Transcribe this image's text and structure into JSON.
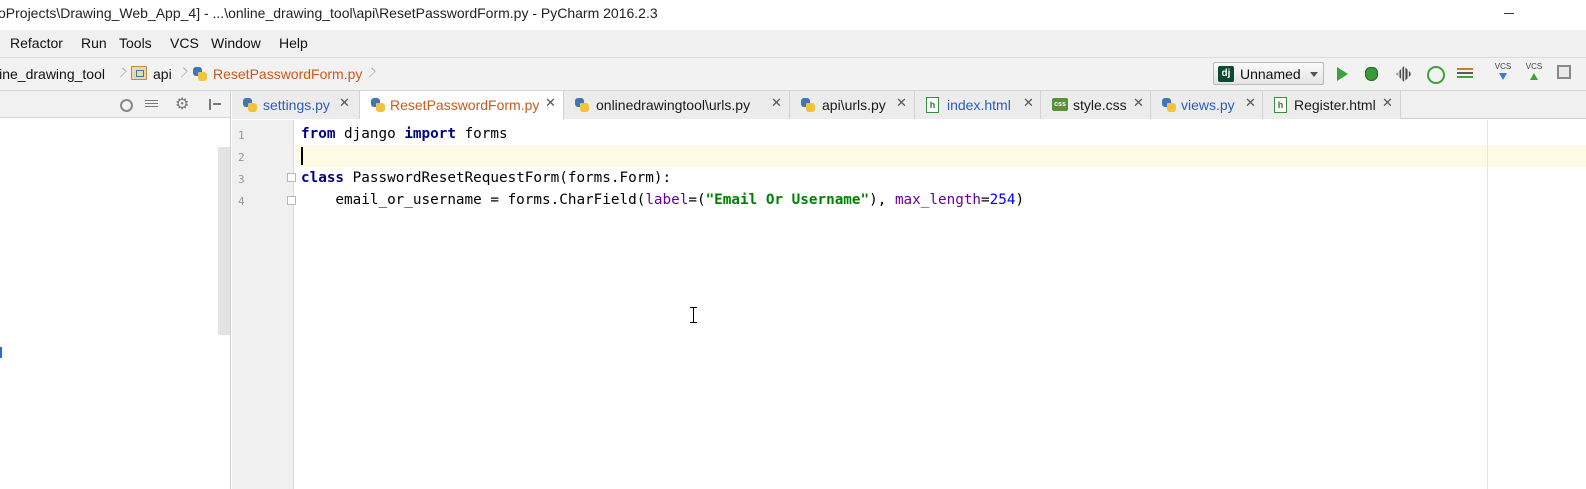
{
  "window": {
    "title": "oProjects\\Drawing_Web_App_4] - ...\\online_drawing_tool\\api\\ResetPasswordForm.py - PyCharm 2016.2.3"
  },
  "menu": {
    "items": [
      "Refactor",
      "Run",
      "Tools",
      "VCS",
      "Window",
      "Help"
    ]
  },
  "breadcrumb": {
    "items": [
      "line_drawing_tool",
      "api",
      "ResetPasswordForm.py"
    ]
  },
  "toolbar": {
    "run_config_label": "Unnamed",
    "run_config_icon": "dj",
    "vcs_label": "VCS",
    "icons": [
      "run-icon",
      "debug-icon",
      "coverage-icon",
      "profile-icon",
      "concurrency-icon",
      "vcs-update-icon",
      "vcs-commit-icon",
      "history-icon"
    ]
  },
  "tabs": [
    {
      "label": "settings.py",
      "icon": "python-file-icon",
      "active": false,
      "color": "#2b5fb5"
    },
    {
      "label": "ResetPasswordForm.py",
      "icon": "python-file-icon",
      "active": true,
      "color": "#c85a1e"
    },
    {
      "label": "onlinedrawingtool\\urls.py",
      "icon": "python-file-icon",
      "active": false,
      "color": "#1a1a1a"
    },
    {
      "label": "api\\urls.py",
      "icon": "python-file-icon",
      "active": false,
      "color": "#1a1a1a"
    },
    {
      "label": "index.html",
      "icon": "html-file-icon",
      "active": false,
      "color": "#2b5fb5"
    },
    {
      "label": "style.css",
      "icon": "css-file-icon",
      "active": false,
      "color": "#1a1a1a"
    },
    {
      "label": "views.py",
      "icon": "python-file-icon",
      "active": false,
      "color": "#2b5fb5"
    },
    {
      "label": "Register.html",
      "icon": "html-file-icon",
      "active": false,
      "color": "#1a1a1a"
    }
  ],
  "tab_close_glyph": "✕",
  "editor": {
    "line_numbers": [
      "1",
      "2",
      "3",
      "4"
    ],
    "current_line": 2,
    "lines": {
      "l1": {
        "kw1": "from",
        "t1": " django ",
        "kw2": "import",
        "t2": " forms"
      },
      "l3": {
        "kw1": "class",
        "t1": " PasswordResetRequestForm(forms.Form):"
      },
      "l4": {
        "t1": "    email_or_username = forms.CharField(",
        "p1": "label",
        "t2": "=(",
        "s1": "\"Email Or Username\"",
        "t3": "), ",
        "p2": "max_length",
        "t4": "=",
        "n1": "254",
        "t5": ")"
      }
    }
  },
  "colors": {
    "keyword": "#000080",
    "string": "#008000",
    "number": "#0000ff",
    "param": "#660099",
    "current_line_bg": "#fefbe4"
  }
}
